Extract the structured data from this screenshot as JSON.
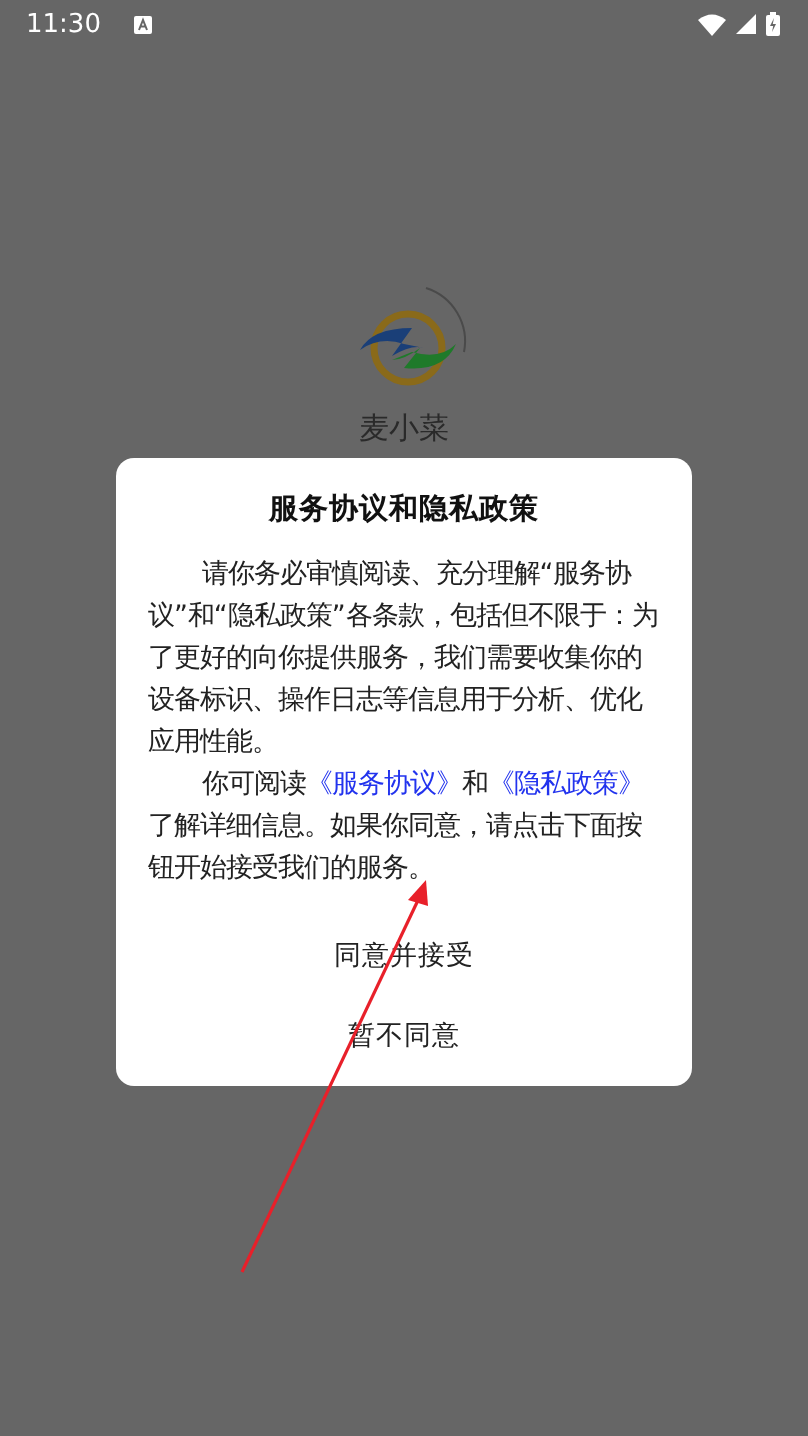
{
  "status_bar": {
    "time": "11:30"
  },
  "app": {
    "name": "麦小菜"
  },
  "dialog": {
    "title": "服务协议和隐私政策",
    "paragraphs": [
      {
        "parts": [
          {
            "kind": "text",
            "text": "请你务必审慎阅读、充分理解“服务协议”和“隐私政策”各条款，包括但不限于：为了更好的向你提供服务，我们需要收集你的设备标识、操作日志等信息用于分析、优化应用性能。"
          }
        ]
      },
      {
        "parts": [
          {
            "kind": "text",
            "text": "你可阅读"
          },
          {
            "kind": "link",
            "text": "《服务协议》"
          },
          {
            "kind": "text",
            "text": "和"
          },
          {
            "kind": "link",
            "text": "《隐私政策》"
          },
          {
            "kind": "text",
            "text": "了解详细信息。如果你同意，请点击下面按钮开始接受我们的服务。"
          }
        ]
      }
    ],
    "buttons": [
      "同意并接受",
      "暂不同意"
    ]
  }
}
